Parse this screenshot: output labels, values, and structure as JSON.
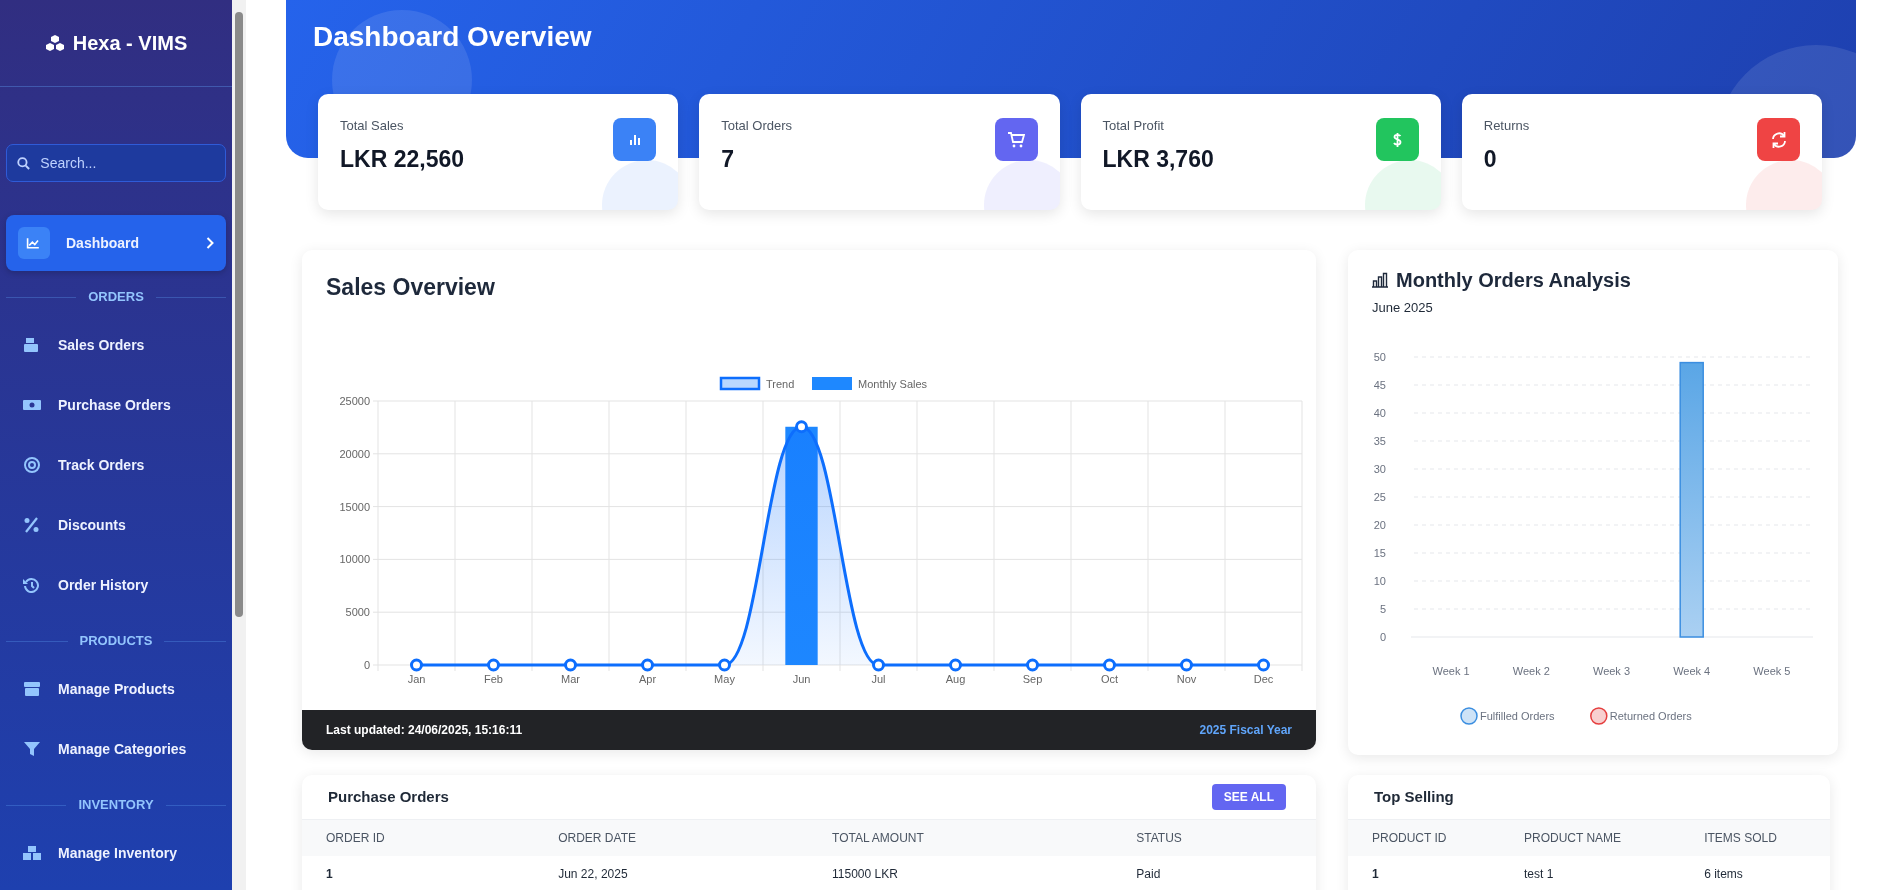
{
  "sidebar": {
    "brand": "Hexa - VIMS",
    "search": {
      "placeholder": "Search..."
    },
    "items": [
      {
        "kind": "link",
        "label": "Dashboard",
        "selected": true
      },
      {
        "kind": "heading",
        "label": "ORDERS"
      },
      {
        "kind": "link",
        "label": "Sales Orders",
        "selected": false
      },
      {
        "kind": "link",
        "label": "Purchase Orders",
        "selected": false
      },
      {
        "kind": "link",
        "label": "Track Orders",
        "selected": false
      },
      {
        "kind": "link",
        "label": "Discounts",
        "selected": false
      },
      {
        "kind": "link",
        "label": "Order History",
        "selected": false
      },
      {
        "kind": "heading",
        "label": "PRODUCTS"
      },
      {
        "kind": "link",
        "label": "Manage Products",
        "selected": false
      },
      {
        "kind": "link",
        "label": "Manage Categories",
        "selected": false
      },
      {
        "kind": "heading",
        "label": "INVENTORY"
      },
      {
        "kind": "link",
        "label": "Manage Inventory",
        "selected": false
      }
    ]
  },
  "header": {
    "title": "Dashboard Overview"
  },
  "stats": [
    {
      "label": "Total Sales",
      "value": "LKR 22,560",
      "color": "#3b82f6"
    },
    {
      "label": "Total Orders",
      "value": "7",
      "color": "#6366f1"
    },
    {
      "label": "Total Profit",
      "value": "LKR 3,760",
      "color": "#22c55e"
    },
    {
      "label": "Returns",
      "value": "0",
      "color": "#ef4444"
    }
  ],
  "sales_overview": {
    "title": "Sales Overview",
    "footer_left": "Last updated: 24/06/2025, 15:16:11",
    "footer_right": "2025 Fiscal Year",
    "chart_data": {
      "type": "bar",
      "categories": [
        "Jan",
        "Feb",
        "Mar",
        "Apr",
        "May",
        "Jun",
        "Jul",
        "Aug",
        "Sep",
        "Oct",
        "Nov",
        "Dec"
      ],
      "series": [
        {
          "name": "Trend",
          "type": "line",
          "marker": "circle",
          "color": "#0d6efd",
          "values": [
            0,
            0,
            0,
            0,
            0,
            22560,
            0,
            0,
            0,
            0,
            0,
            0
          ]
        },
        {
          "name": "Monthly Sales",
          "type": "bar",
          "color": "#1e88ff",
          "values": [
            0,
            0,
            0,
            0,
            0,
            22560,
            0,
            0,
            0,
            0,
            0,
            0
          ]
        }
      ],
      "grid": true,
      "legend": "top",
      "ylim": [
        0,
        25000
      ],
      "yticks": [
        0,
        5000,
        10000,
        15000,
        20000,
        25000
      ]
    }
  },
  "monthly_orders": {
    "title": "Monthly Orders Analysis",
    "subtitle": "June 2025",
    "chart_data": {
      "type": "bar",
      "categories": [
        "Week 1",
        "Week 2",
        "Week 3",
        "Week 4",
        "Week 5"
      ],
      "series": [
        {
          "name": "Fulfilled Orders",
          "color": "#3b8ee0",
          "values": [
            0,
            0,
            0,
            49,
            0
          ]
        },
        {
          "name": "Returned Orders",
          "color": "#e53e3e",
          "values": [
            0,
            0,
            0,
            0,
            0
          ]
        }
      ],
      "grid": true,
      "ylim": [
        0,
        50
      ],
      "yticks": [
        0,
        5,
        10,
        15,
        20,
        25,
        30,
        35,
        40,
        45,
        50
      ]
    }
  },
  "purchase_orders": {
    "title": "Purchase Orders",
    "button": "SEE ALL",
    "columns": [
      "ORDER ID",
      "ORDER DATE",
      "TOTAL AMOUNT",
      "STATUS"
    ],
    "rows": [
      [
        "1",
        "Jun 22, 2025",
        "115000 LKR",
        "Paid"
      ]
    ]
  },
  "top_selling": {
    "title": "Top Selling",
    "columns": [
      "PRODUCT ID",
      "PRODUCT NAME",
      "ITEMS SOLD"
    ],
    "rows": [
      [
        "1",
        "test 1",
        "6 items"
      ]
    ]
  }
}
